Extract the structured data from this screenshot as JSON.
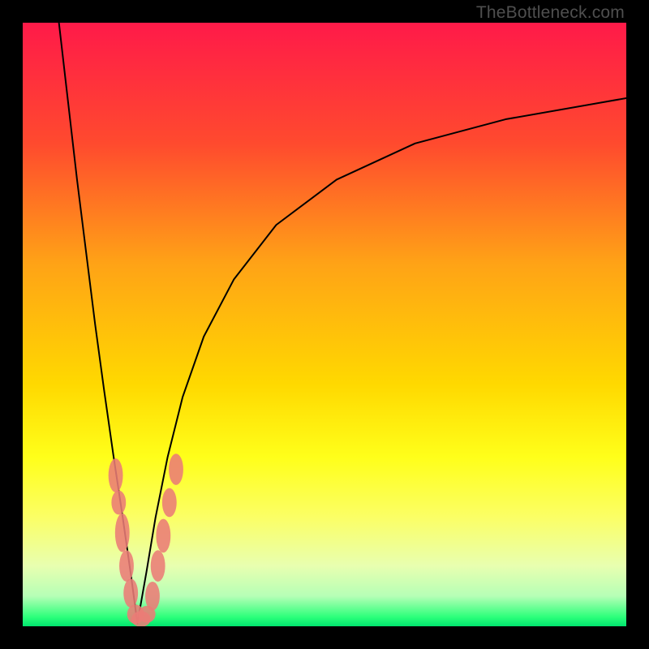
{
  "watermark": "TheBottleneck.com",
  "colors": {
    "frame": "#000000",
    "watermark_text": "#4f4f4f",
    "curve": "#000000",
    "marker_fill": "#eb7c76",
    "gradient_stops": [
      {
        "offset": 0.0,
        "color": "#ff1a49"
      },
      {
        "offset": 0.2,
        "color": "#ff4a2e"
      },
      {
        "offset": 0.4,
        "color": "#ffa316"
      },
      {
        "offset": 0.6,
        "color": "#ffd900"
      },
      {
        "offset": 0.72,
        "color": "#ffff1a"
      },
      {
        "offset": 0.82,
        "color": "#fbff66"
      },
      {
        "offset": 0.9,
        "color": "#e8ffb0"
      },
      {
        "offset": 0.95,
        "color": "#b6ffb6"
      },
      {
        "offset": 0.985,
        "color": "#2bff7a"
      },
      {
        "offset": 1.0,
        "color": "#00e56e"
      }
    ]
  },
  "chart_data": {
    "type": "line",
    "title": "",
    "xlabel": "",
    "ylabel": "",
    "x": [
      0,
      100
    ],
    "ylim": [
      0,
      100
    ],
    "note": "Axes unlabeled in source image; x and y ranges normalized 0–100. Curve is a V-shaped bottleneck curve with minimum near x≈19, y≈0.",
    "series": [
      {
        "name": "bottleneck-curve-left",
        "x": [
          6.0,
          7.5,
          9.0,
          10.5,
          12.0,
          13.5,
          15.0,
          16.5,
          18.0,
          19.0
        ],
        "y": [
          100.0,
          87.0,
          74.0,
          62.0,
          50.0,
          39.0,
          28.5,
          18.5,
          8.0,
          0.5
        ]
      },
      {
        "name": "bottleneck-curve-right",
        "x": [
          19.0,
          20.5,
          22.0,
          24.0,
          26.5,
          30.0,
          35.0,
          42.0,
          52.0,
          65.0,
          80.0,
          100.0
        ],
        "y": [
          0.5,
          9.0,
          18.0,
          28.0,
          38.0,
          48.0,
          57.5,
          66.5,
          74.0,
          80.0,
          84.0,
          87.5
        ]
      }
    ],
    "markers": [
      {
        "x": 15.4,
        "y": 25.0,
        "rx": 1.2,
        "ry": 2.8
      },
      {
        "x": 15.9,
        "y": 20.5,
        "rx": 1.2,
        "ry": 2.0
      },
      {
        "x": 16.5,
        "y": 15.5,
        "rx": 1.2,
        "ry": 3.2
      },
      {
        "x": 17.2,
        "y": 10.0,
        "rx": 1.2,
        "ry": 2.6
      },
      {
        "x": 17.9,
        "y": 5.5,
        "rx": 1.2,
        "ry": 2.4
      },
      {
        "x": 18.7,
        "y": 2.0,
        "rx": 1.4,
        "ry": 1.6
      },
      {
        "x": 19.6,
        "y": 1.2,
        "rx": 1.6,
        "ry": 1.3
      },
      {
        "x": 20.6,
        "y": 2.0,
        "rx": 1.4,
        "ry": 1.4
      },
      {
        "x": 21.5,
        "y": 5.0,
        "rx": 1.2,
        "ry": 2.4
      },
      {
        "x": 22.4,
        "y": 10.0,
        "rx": 1.2,
        "ry": 2.6
      },
      {
        "x": 23.3,
        "y": 15.0,
        "rx": 1.2,
        "ry": 2.8
      },
      {
        "x": 24.3,
        "y": 20.5,
        "rx": 1.2,
        "ry": 2.4
      },
      {
        "x": 25.4,
        "y": 26.0,
        "rx": 1.2,
        "ry": 2.6
      }
    ]
  }
}
